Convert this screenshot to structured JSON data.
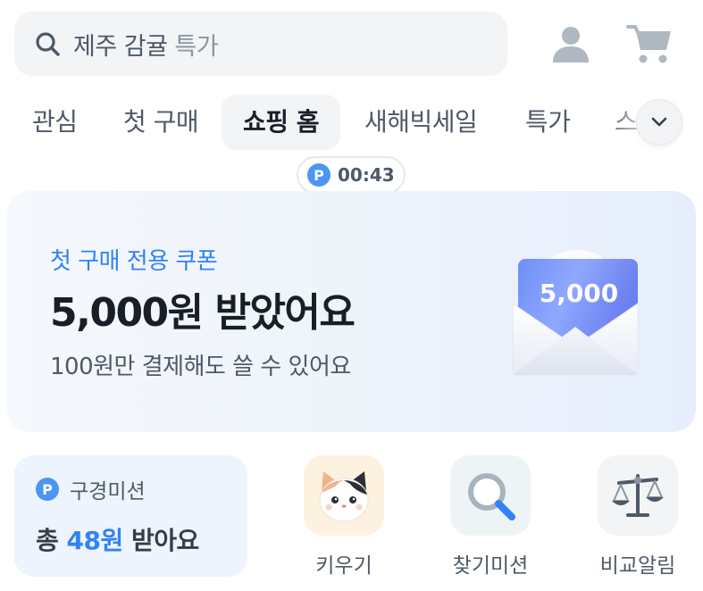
{
  "search": {
    "query_hint": "제주 감귤",
    "suffix_hint": "특가"
  },
  "header_icons": [
    "profile-icon",
    "cart-icon"
  ],
  "tabs": [
    {
      "label": "관심"
    },
    {
      "label": "첫 구매"
    },
    {
      "label": "쇼핑 홈",
      "active": true
    },
    {
      "label": "새해빅세일"
    },
    {
      "label": "특가"
    },
    {
      "label": "스"
    }
  ],
  "timer": {
    "badge": "P",
    "time": "00:43"
  },
  "banner": {
    "subtitle": "첫 구매 전용 쿠폰",
    "title": "5,000원 받았어요",
    "description": "100원만 결제해도 쓸 수 있어요",
    "coupon_value": "5,000"
  },
  "mission": {
    "badge": "P",
    "label": "구경미션",
    "total_prefix": "총",
    "amount": "48원",
    "total_suffix": "받아요"
  },
  "features": [
    {
      "label": "키우기",
      "icon": "cat-icon"
    },
    {
      "label": "찾기미션",
      "icon": "magnifier-icon"
    },
    {
      "label": "비교알림",
      "icon": "scale-icon"
    }
  ],
  "colors": {
    "accent": "#3182f6",
    "badge": "#4b96f3",
    "text_primary": "#191f28",
    "text_secondary": "#4e5968",
    "surface": "#f2f4f6"
  }
}
